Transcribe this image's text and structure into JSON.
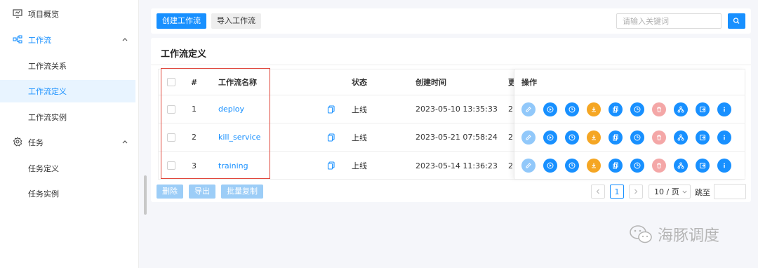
{
  "sidebar": {
    "items": [
      {
        "label": "项目概览",
        "icon": "monitor-icon"
      },
      {
        "label": "工作流",
        "icon": "workflow-icon",
        "expanded": true
      },
      {
        "label": "工作流关系"
      },
      {
        "label": "工作流定义",
        "active": true
      },
      {
        "label": "工作流实例"
      },
      {
        "label": "任务",
        "icon": "gear-icon",
        "expanded": true
      },
      {
        "label": "任务定义"
      },
      {
        "label": "任务实例"
      }
    ]
  },
  "toolbar": {
    "create_label": "创建工作流",
    "import_label": "导入工作流",
    "search_placeholder": "请输入关键词"
  },
  "main": {
    "title": "工作流定义",
    "columns": {
      "index": "#",
      "name": "工作流名称",
      "status": "状态",
      "created": "创建时间",
      "truncated": "更",
      "operations": "操作"
    },
    "rows": [
      {
        "index": "1",
        "name": "deploy",
        "status": "上线",
        "created": "2023-05-10 13:35:33",
        "updated_prefix": "2"
      },
      {
        "index": "2",
        "name": "kill_service",
        "status": "上线",
        "created": "2023-05-21 07:58:24",
        "updated_prefix": "2"
      },
      {
        "index": "3",
        "name": "training",
        "status": "上线",
        "created": "2023-05-14 11:36:23",
        "updated_prefix": "2"
      }
    ],
    "operation_icons": [
      "edit-icon",
      "run-icon",
      "timing-icon",
      "download-icon",
      "copy-icon",
      "timer-manage-icon",
      "delete-icon",
      "tree-icon",
      "export-icon",
      "info-icon"
    ]
  },
  "footer": {
    "delete_label": "删除",
    "export_label": "导出",
    "batch_copy_label": "批量复制",
    "current_page": "1",
    "page_size": "10 / 页",
    "jump_label": "跳至"
  },
  "watermark": {
    "text": "海豚调度"
  },
  "colors": {
    "primary": "#1890ff",
    "highlight": "#e0453a",
    "orange": "#f5a623",
    "delete": "#f4a7a7"
  }
}
